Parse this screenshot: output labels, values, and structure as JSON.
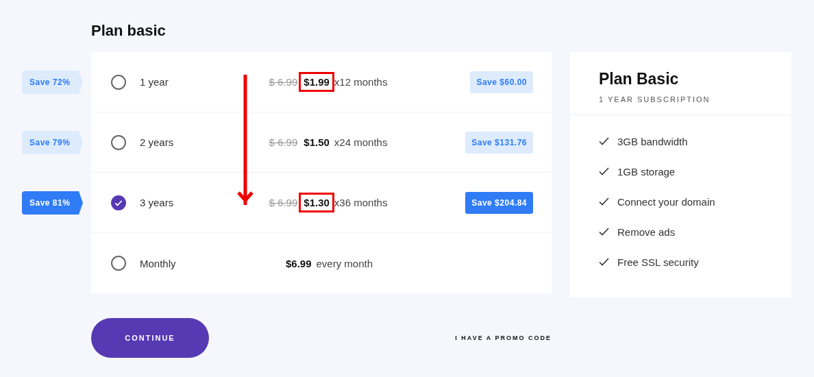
{
  "title": "Plan basic",
  "plans": [
    {
      "tag": "Save 72%",
      "label": "1 year",
      "old_price": "$ 6.99",
      "price": "$1.99",
      "period": "x12 months",
      "save": "Save $60.00",
      "selected": false,
      "highlighted": true
    },
    {
      "tag": "Save 79%",
      "label": "2 years",
      "old_price": "$ 6.99",
      "price": "$1.50",
      "period": "x24 months",
      "save": "Save $131.76",
      "selected": false,
      "highlighted": false
    },
    {
      "tag": "Save 81%",
      "label": "3 years",
      "old_price": "$ 6.99",
      "price": "$1.30",
      "period": "x36 months",
      "save": "Save $204.84",
      "selected": true,
      "highlighted": true
    },
    {
      "label": "Monthly",
      "price": "$6.99",
      "period": "every month",
      "selected": false,
      "highlighted": false
    }
  ],
  "summary": {
    "title": "Plan Basic",
    "subtitle": "1 YEAR SUBSCRIPTION",
    "features": [
      "3GB bandwidth",
      "1GB storage",
      "Connect your domain",
      "Remove ads",
      "Free SSL security"
    ]
  },
  "continue_button": "CONTINUE",
  "promo_link": "I HAVE A PROMO CODE"
}
